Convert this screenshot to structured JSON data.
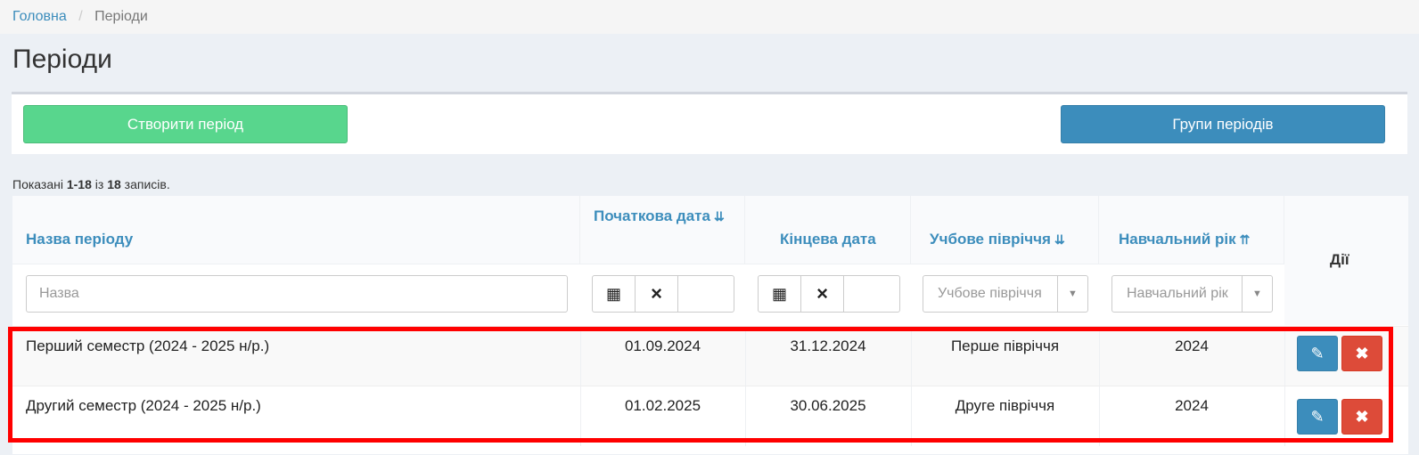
{
  "breadcrumb": {
    "home": "Головна",
    "separator": "/",
    "current": "Періоди"
  },
  "page": {
    "title": "Періоди"
  },
  "toolbar": {
    "create_label": "Створити період",
    "groups_label": "Групи періодів"
  },
  "summary": {
    "prefix": "Показані ",
    "range": "1-18",
    "middle": " із ",
    "total": "18",
    "suffix": " записів."
  },
  "table": {
    "headers": {
      "name": "Назва періоду",
      "start_date": "Початкова дата",
      "end_date": "Кінцева дата",
      "semester": "Учбове півріччя",
      "year": "Навчальний рік",
      "actions": "Дії"
    },
    "filters": {
      "name_placeholder": "Назва",
      "semester_placeholder": "Учбове півріччя",
      "year_placeholder": "Навчальний рік"
    },
    "rows": [
      {
        "name": "Перший семестр (2024 - 2025 н/р.)",
        "start": "01.09.2024",
        "end": "31.12.2024",
        "semester": "Перше півріччя",
        "year": "2024"
      },
      {
        "name": "Другий семестр (2024 - 2025 н/р.)",
        "start": "01.02.2025",
        "end": "30.06.2025",
        "semester": "Друге півріччя",
        "year": "2024"
      }
    ]
  },
  "icons": {
    "sort_asc": "sort-amount-asc-icon",
    "sort_desc": "sort-amount-desc-icon",
    "calendar": "calendar-icon",
    "clear": "clear-icon",
    "dropdown": "caret-down-icon",
    "edit": "pencil-icon",
    "delete": "delete-icon"
  },
  "colors": {
    "primary": "#3c8dbc",
    "success": "#58d68d",
    "danger": "#dd4b39",
    "highlight": "#ff0000"
  }
}
